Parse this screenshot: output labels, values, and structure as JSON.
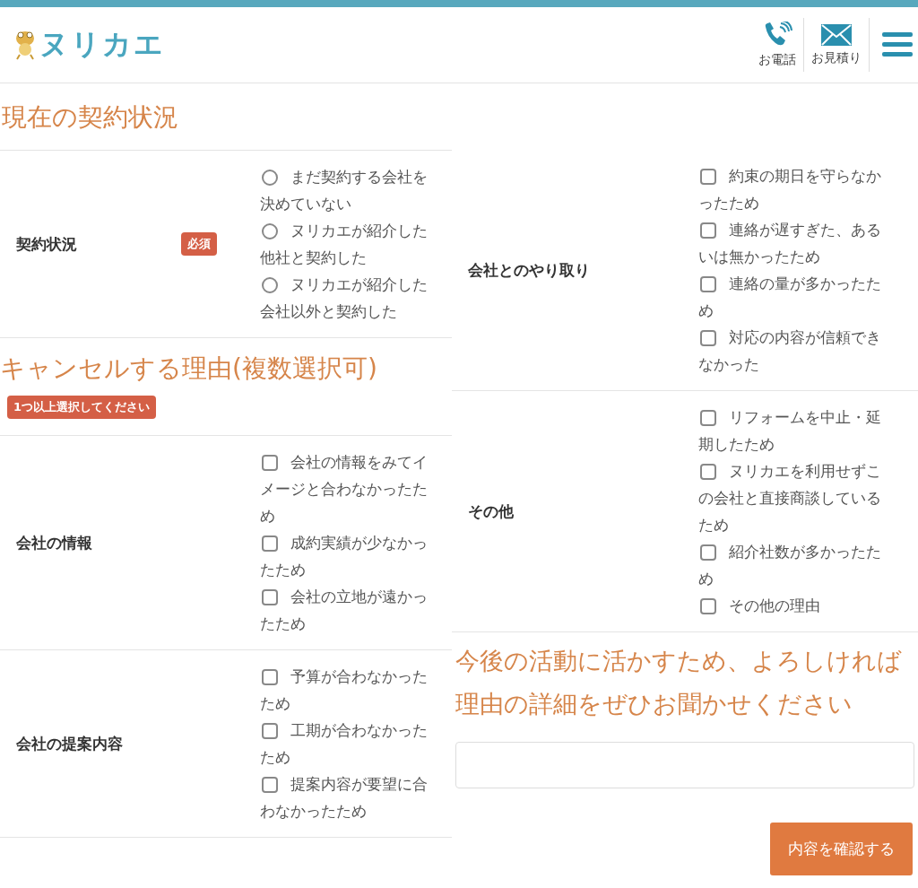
{
  "header": {
    "logo": "ヌリカエ",
    "actions": [
      {
        "kind": "phone",
        "label": "お電話"
      },
      {
        "kind": "mail",
        "label": "お見積り"
      }
    ]
  },
  "left": [
    {
      "kind": "heading",
      "text": "現在の契約状況"
    },
    {
      "kind": "radio_row",
      "label": "契約状況",
      "badge": "必須",
      "options": [
        {
          "text": "まだ契約する会社を決めていない",
          "selected": false
        },
        {
          "text": "ヌリカエが紹介した他社と契約した",
          "selected": false
        },
        {
          "text": "ヌリカエが紹介した会社以外と契約した",
          "selected": false
        }
      ]
    },
    {
      "kind": "heading",
      "text": "キャンセルする理由(複数選択可)"
    },
    {
      "kind": "notice",
      "text": "1つ以上選択してください"
    },
    {
      "kind": "checkbox_row",
      "label": "会社の情報",
      "options": [
        {
          "text": "会社の情報をみてイメージと合わなかったため",
          "checked": false
        },
        {
          "text": "成約実績が少なかったため",
          "checked": false
        },
        {
          "text": "会社の立地が遠かったため",
          "checked": false
        }
      ]
    },
    {
      "kind": "checkbox_row",
      "label": "会社の提案内容",
      "options": [
        {
          "text": "予算が合わなかったため",
          "checked": false
        },
        {
          "text": "工期が合わなかったため",
          "checked": false
        },
        {
          "text": "提案内容が要望に合わなかったため",
          "checked": false
        }
      ]
    }
  ],
  "right": [
    {
      "kind": "checkbox_row",
      "label": "会社とのやり取り",
      "options": [
        {
          "text": "約束の期日を守らなかったため",
          "checked": false
        },
        {
          "text": "連絡が遅すぎた、あるいは無かったため",
          "checked": false
        },
        {
          "text": "連絡の量が多かったため",
          "checked": false
        },
        {
          "text": "対応の内容が信頼できなかった",
          "checked": false
        }
      ]
    },
    {
      "kind": "checkbox_row",
      "label": "その他",
      "options": [
        {
          "text": "リフォームを中止・延期したため",
          "checked": false
        },
        {
          "text": "ヌリカエを利用せずこの会社と直接商談しているため",
          "checked": false
        },
        {
          "text": "紹介社数が多かったため",
          "checked": false
        },
        {
          "text": "その他の理由",
          "checked": false
        }
      ]
    },
    {
      "kind": "heading",
      "text": "今後の活動に活かすため、よろしければ理由の詳細をぜひお聞かせください"
    },
    {
      "kind": "textarea"
    },
    {
      "kind": "submit",
      "text": "内容を確認する"
    }
  ]
}
